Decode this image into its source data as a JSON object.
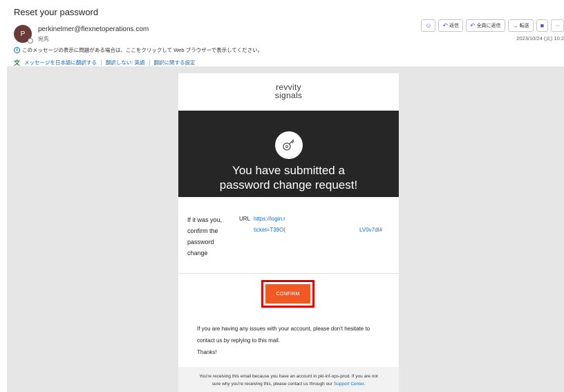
{
  "email": {
    "subject": "Reset your password",
    "sender_initial": "P",
    "sender": "perkinelmer@flexnetoperations.com",
    "to_label": "宛先",
    "info_text": "このメッセージの表示に問題がある場合は、ここをクリックして Web ブラウザーで表示してください。",
    "translate": {
      "translate_link": "メッセージを日本語に翻訳する",
      "dont_translate": "翻訳しない: 英語",
      "settings": "翻訳に関する設定"
    },
    "date": "2023/10/24 (火) 10:2"
  },
  "toolbar": {
    "reply": "返信",
    "reply_all": "全員に返信",
    "forward": "転送",
    "more": "···"
  },
  "card": {
    "logo_line1": "revvity",
    "logo_line2": "signals",
    "hero_title_line1": "You have submitted a",
    "hero_title_line2": "password change request!",
    "instruction_lines": [
      "If it was you,",
      "confirm the",
      "password",
      "change"
    ],
    "url_label": "URL",
    "url_part1": "https://login.r",
    "url_part2": "ticket=T39O(",
    "url_part3": "LV0v7dI#",
    "confirm_label": "CONFIRM",
    "help_line1": "If you are having any issues with your account, please don't hesitate to",
    "help_line2": "contact us by replying to this mail.",
    "help_line3": "Thanks!",
    "footer_line1": "You're receiving this email because you have an account in pki-inf-ops-prod. If you are not",
    "footer_line2_prefix": "sure why you're receiving this, please contact us through our ",
    "footer_link": "Support Center",
    "footer_suffix": "."
  },
  "colors": {
    "hero_bg": "#262626",
    "confirm_bg": "#f05a22",
    "highlight_border": "#e00000",
    "link": "#1a6fd1",
    "avatar_bg": "#6b3b37"
  },
  "icons": {
    "hero": "key-search-icon",
    "emoji": "smiley-icon",
    "reply": "reply-icon",
    "reply_all": "reply-all-icon",
    "forward": "forward-icon",
    "teams": "teams-icon"
  }
}
